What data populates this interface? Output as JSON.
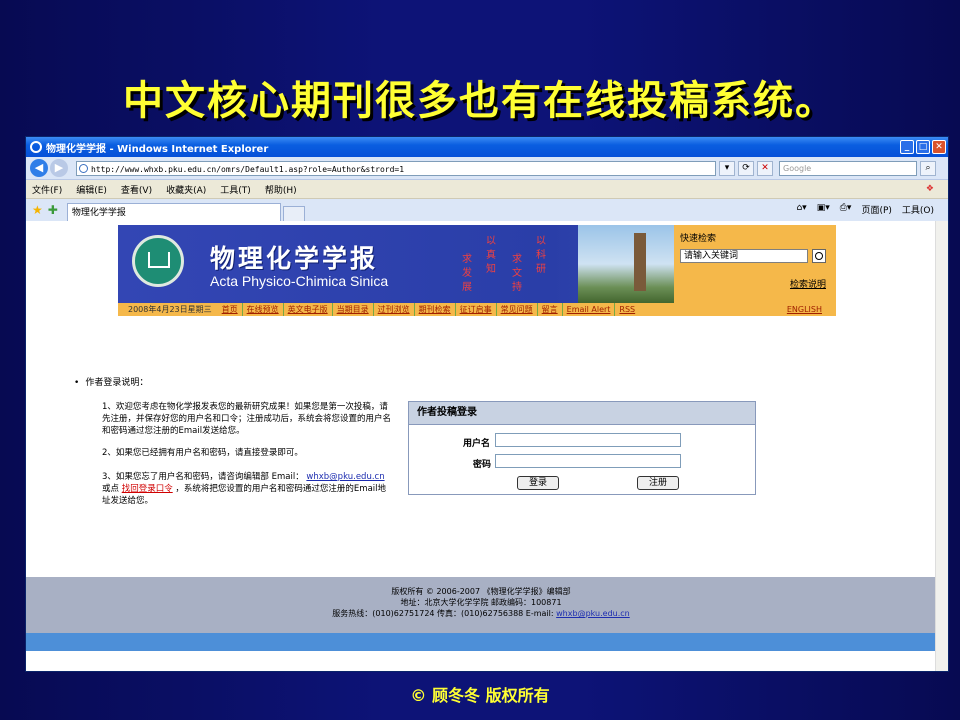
{
  "slide": {
    "title": "中文核心期刊很多也有在线投稿系统。",
    "copyright": "© 顾冬冬 版权所有"
  },
  "browser": {
    "window_title": "物理化学学报 - Windows Internet Explorer",
    "url": "http://www.whxb.pku.edu.cn/omrs/Default1.asp?role=Author&strord=1",
    "search_placeholder": "Google",
    "menu": [
      "文件(F)",
      "编辑(E)",
      "查看(V)",
      "收藏夹(A)",
      "工具(T)",
      "帮助(H)"
    ],
    "tab_label": "物理化学学报",
    "tab_tools": [
      "页面(P)",
      "工具(O)"
    ]
  },
  "journal": {
    "title_cn": "物理化学学报",
    "title_en": "Acta Physico-Chimica Sinica",
    "motto": [
      "求",
      "发",
      "展",
      "求",
      "真",
      "知",
      "求",
      "文",
      "持",
      "求",
      "科",
      "研",
      "以",
      "以"
    ],
    "quick_search": {
      "title": "快速检索",
      "input_value": "请输入关键词",
      "help": "检索说明"
    },
    "nav": {
      "date": "2008年4月23日星期三",
      "items": [
        "首页",
        "在线预览",
        "英文电子版",
        "当期目录",
        "过刊浏览",
        "期刊检索",
        "征订启事",
        "常见问题",
        "留言",
        "Email Alert",
        "RSS"
      ],
      "english": "ENGLISH"
    }
  },
  "instructions": {
    "title": "作者登录说明：",
    "p1": "1、欢迎您考虑在物化学报发表您的最新研究成果！如果您是第一次投稿，请先注册，并保存好您的用户名和口令；注册成功后，系统会将您设置的用户名和密码通过您注册的Email发送给您。",
    "p2": "2、如果您已经拥有用户名和密码，请直接登录即可。",
    "p3_a": "3、如果您忘了用户名和密码，请咨询编辑部 Email：",
    "p3_email": "whxb@pku.edu.cn",
    "p3_b": " 或点 ",
    "p3_link": "找回登录口令",
    "p3_c": "，系统将把您设置的用户名和密码通过您注册的Email地址发送给您。"
  },
  "login": {
    "title": "作者投稿登录",
    "username_label": "用户名",
    "password_label": "密码",
    "login_button": "登录",
    "register_button": "注册"
  },
  "footer": {
    "line1": "版权所有 © 2006-2007 《物理化学学报》编辑部",
    "line2": "地址：北京大学化学学院 邮政编码：100871",
    "line3": "服务热线：(010)62751724 传真：(010)62756388 E-mail:",
    "email": "whxb@pku.edu.cn"
  }
}
